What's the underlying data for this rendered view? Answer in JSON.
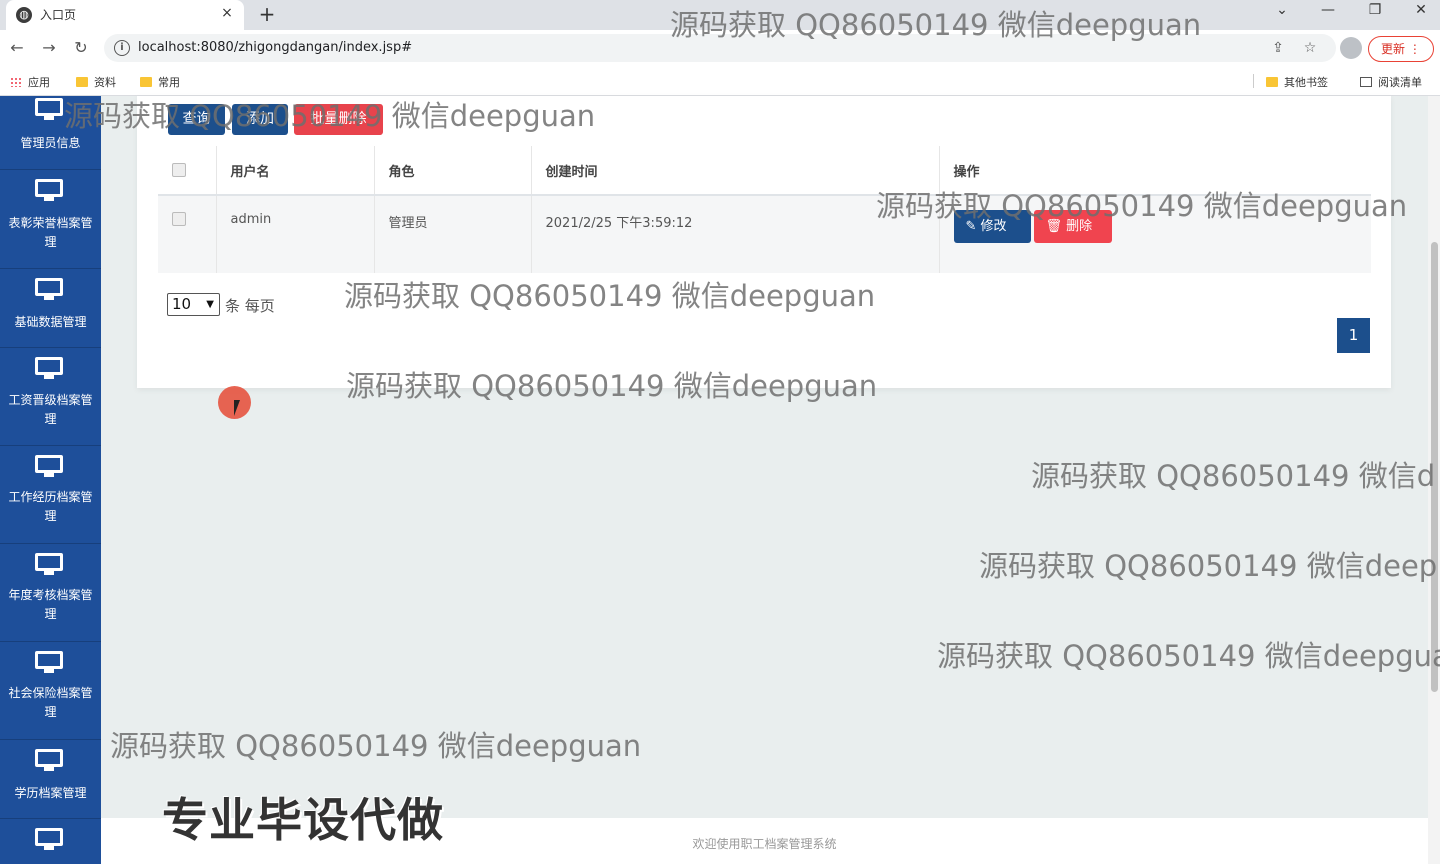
{
  "browser": {
    "tab_title": "入口页",
    "tab_close": "×",
    "new_tab": "+",
    "window_controls": [
      "⌄",
      "—",
      "❐",
      "✕"
    ],
    "url": "localhost:8080/zhigongdangan/index.jsp#",
    "update_label": "更新 ⋮",
    "bookmarks": [
      "应用",
      "资料",
      "常用"
    ],
    "bookmarks_right": [
      "其他书签",
      "阅读清单"
    ]
  },
  "sidebar": {
    "items": [
      {
        "label": "管理员信息"
      },
      {
        "label": "表彰荣誉档案管理"
      },
      {
        "label": "基础数据管理"
      },
      {
        "label": "工资晋级档案管理"
      },
      {
        "label": "工作经历档案管理"
      },
      {
        "label": "年度考核档案管理"
      },
      {
        "label": "社会保险档案管理"
      },
      {
        "label": "学历档案管理"
      },
      {
        "label": ""
      }
    ]
  },
  "actions": {
    "query": "查询",
    "add": "添加",
    "batch_delete": "批量删除"
  },
  "table": {
    "headers": [
      "用户名",
      "角色",
      "创建时间",
      "操作"
    ],
    "rows": [
      {
        "username": "admin",
        "role": "管理员",
        "created": "2021/2/25 下午3:59:12",
        "edit": "修改",
        "delete": "删除"
      }
    ]
  },
  "pager": {
    "page_size": "10",
    "per_page_label": "条 每页",
    "current_page": "1"
  },
  "footer": {
    "text": "欢迎使用职工档案管理系统"
  },
  "watermarks": {
    "line": "源码获取 QQ86050149 微信deepguan",
    "line_cut1": "源码获取 QQ86050149 微信d",
    "line_cut2": "源码获取 QQ86050149 微信deep",
    "line_cut3": "源码获取 QQ86050149 微信deepgua",
    "big": "专业毕设代做"
  },
  "colors": {
    "sidebar": "#1e4f9a",
    "primary": "#1c4f8c",
    "danger": "#e8434c"
  }
}
